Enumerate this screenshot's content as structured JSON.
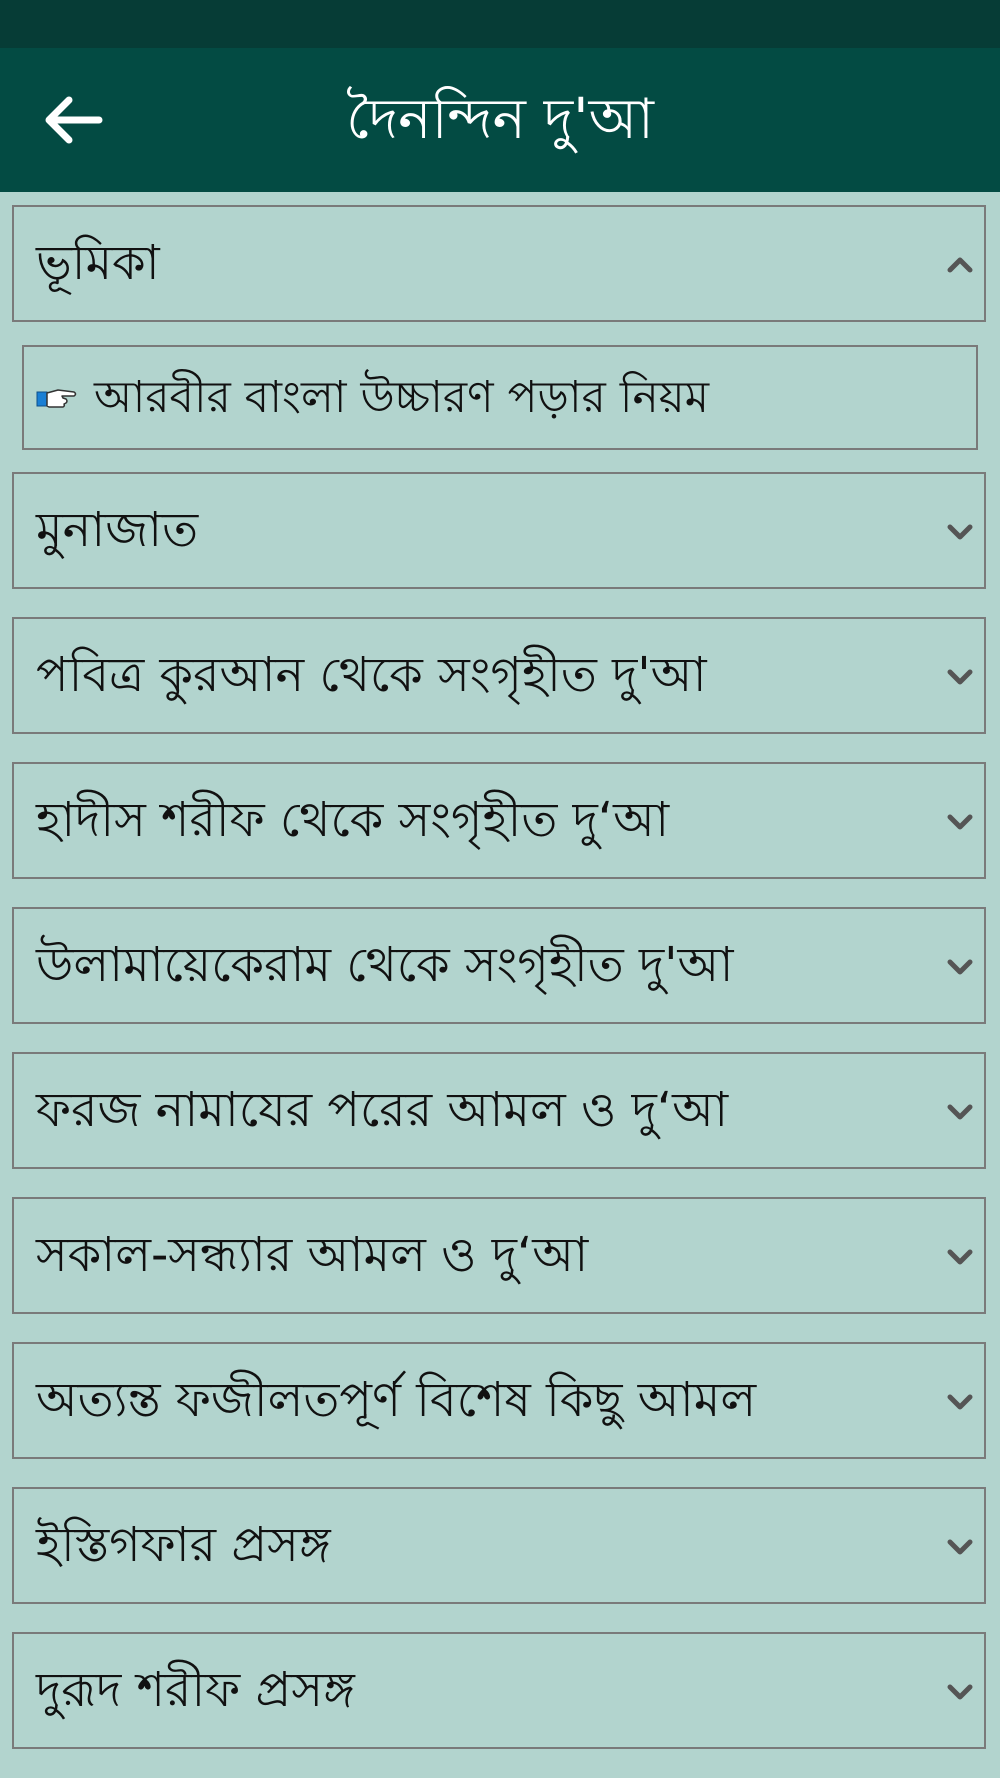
{
  "header": {
    "title": "দৈনন্দিন দু'আ",
    "back_icon": "arrow-left-icon"
  },
  "colors": {
    "status_bar": "#063c36",
    "app_bar": "#034b43",
    "background": "#b2d4ce",
    "border": "#7a7a7a",
    "chevron": "#555555"
  },
  "sections": [
    {
      "label": "ভূমিকা",
      "expanded": true,
      "icon": "chevron-up-icon"
    },
    {
      "label": "মুনাজাত",
      "expanded": false,
      "icon": "chevron-down-icon"
    },
    {
      "label": "পবিত্র কুরআন থেকে সংগৃহীত দু'আ",
      "expanded": false,
      "icon": "chevron-down-icon"
    },
    {
      "label": "হাদীস শরীফ থেকে সংগৃহীত দু‘আ",
      "expanded": false,
      "icon": "chevron-down-icon"
    },
    {
      "label": "উলামায়েকেরাম থেকে সংগৃহীত দু'আ",
      "expanded": false,
      "icon": "chevron-down-icon"
    },
    {
      "label": "ফরজ নামাযের পরের আমল ও দু‘আ",
      "expanded": false,
      "icon": "chevron-down-icon"
    },
    {
      "label": "সকাল-সন্ধ্যার আমল ও দু‘আ",
      "expanded": false,
      "icon": "chevron-down-icon"
    },
    {
      "label": "অত্যন্ত ফজীলতপূর্ণ বিশেষ কিছু আমল",
      "expanded": false,
      "icon": "chevron-down-icon"
    },
    {
      "label": "ইস্তিগফার প্রসঙ্গ",
      "expanded": false,
      "icon": "chevron-down-icon"
    },
    {
      "label": "দুরূদ শরীফ প্রসঙ্গ",
      "expanded": false,
      "icon": "chevron-down-icon"
    }
  ],
  "intro_subitem": {
    "label": "আরবীর বাংলা উচ্চারণ পড়ার নিয়ম",
    "icon": "pointing-hand-icon"
  }
}
